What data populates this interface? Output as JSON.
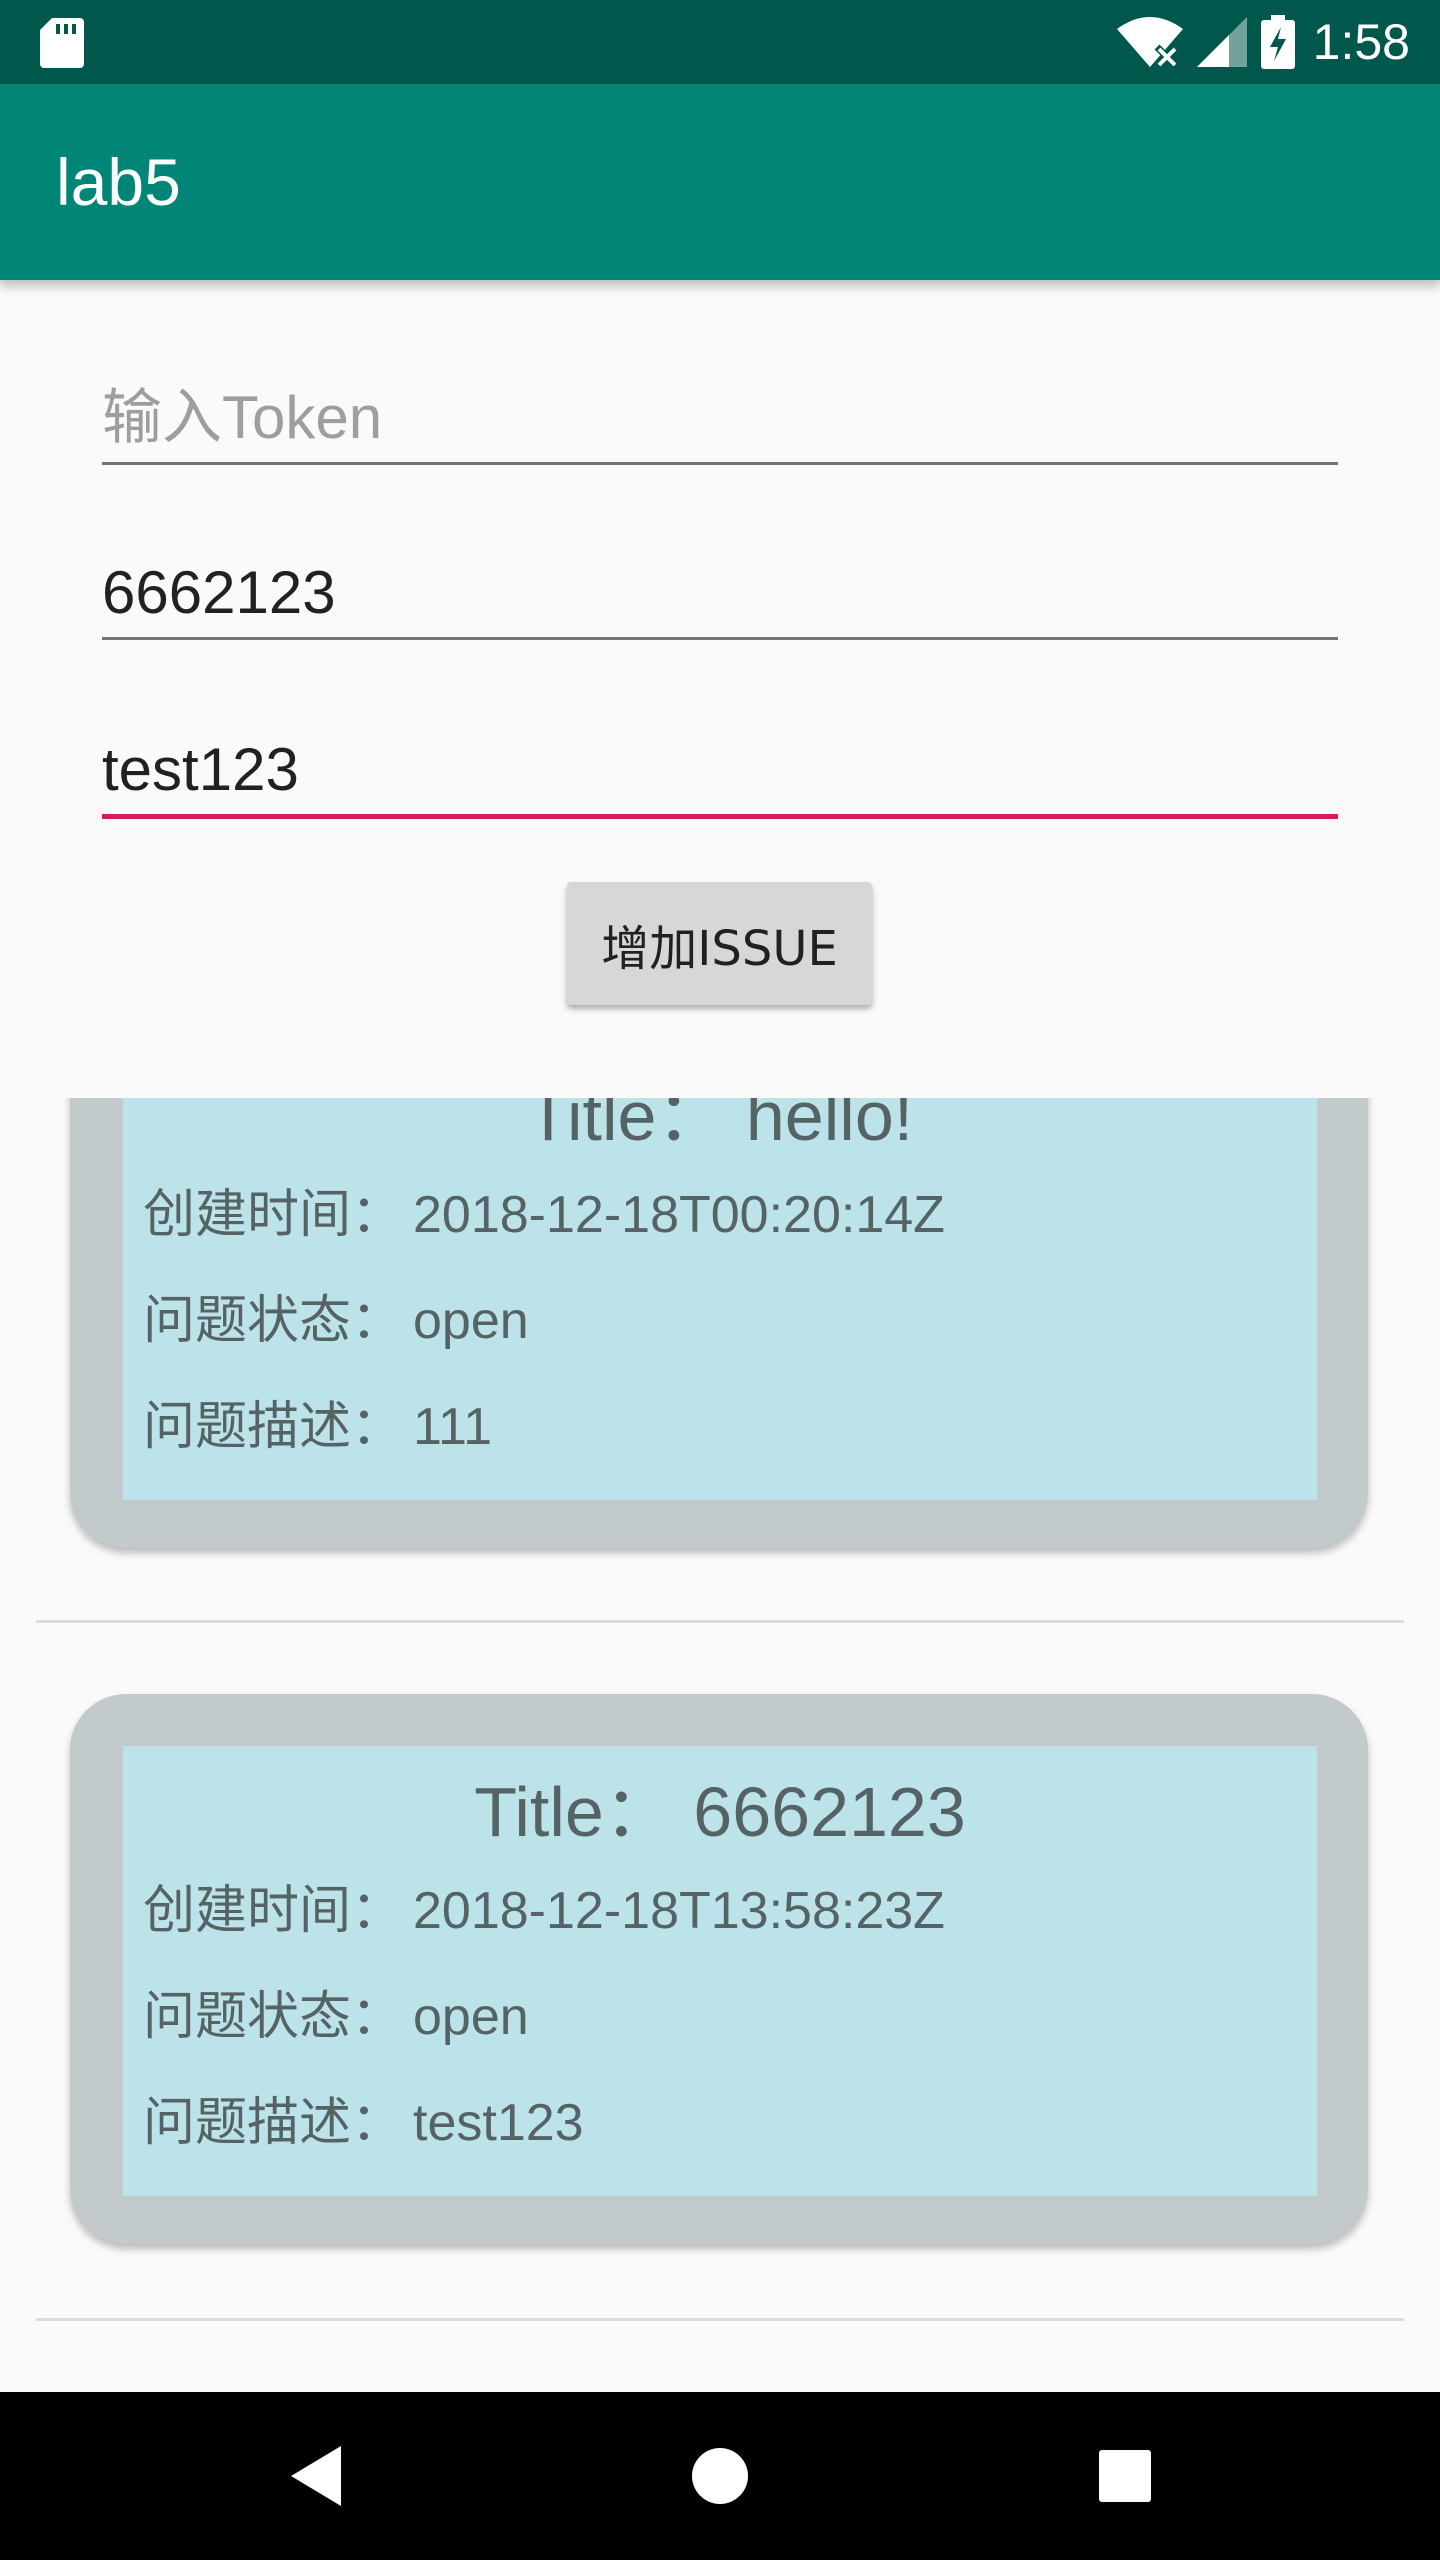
{
  "status_bar": {
    "time": "1:58",
    "icons": [
      "sd-card-icon",
      "wifi-off-icon",
      "signal-icon",
      "battery-charging-icon"
    ]
  },
  "app_bar": {
    "title": "lab5"
  },
  "form": {
    "token_input": {
      "value": "",
      "placeholder": "输入Token"
    },
    "title_input": {
      "value": "6662123",
      "placeholder": ""
    },
    "body_input": {
      "value": "test123",
      "placeholder": ""
    },
    "add_button_label": "增加ISSUE"
  },
  "issues": [
    {
      "title": "Title：  hello!",
      "created_label": "创建时间：",
      "created_at": "2018-12-18T00:20:14Z",
      "state_label": "问题状态：",
      "state": "open",
      "body_label": "问题描述：",
      "body": "111"
    },
    {
      "title": "Title：  6662123",
      "created_label": "创建时间：",
      "created_at": "2018-12-18T13:58:23Z",
      "state_label": "问题状态：",
      "state": "open",
      "body_label": "问题描述：",
      "body": "test123"
    }
  ],
  "nav_bar": {
    "icons": [
      "back-icon",
      "home-icon",
      "recents-icon"
    ]
  },
  "colors": {
    "primary": "#008577",
    "primary_dark": "#00574b",
    "accent": "#d81b60",
    "card_outer": "#c3cacb",
    "card_inner": "#bce3e9"
  }
}
